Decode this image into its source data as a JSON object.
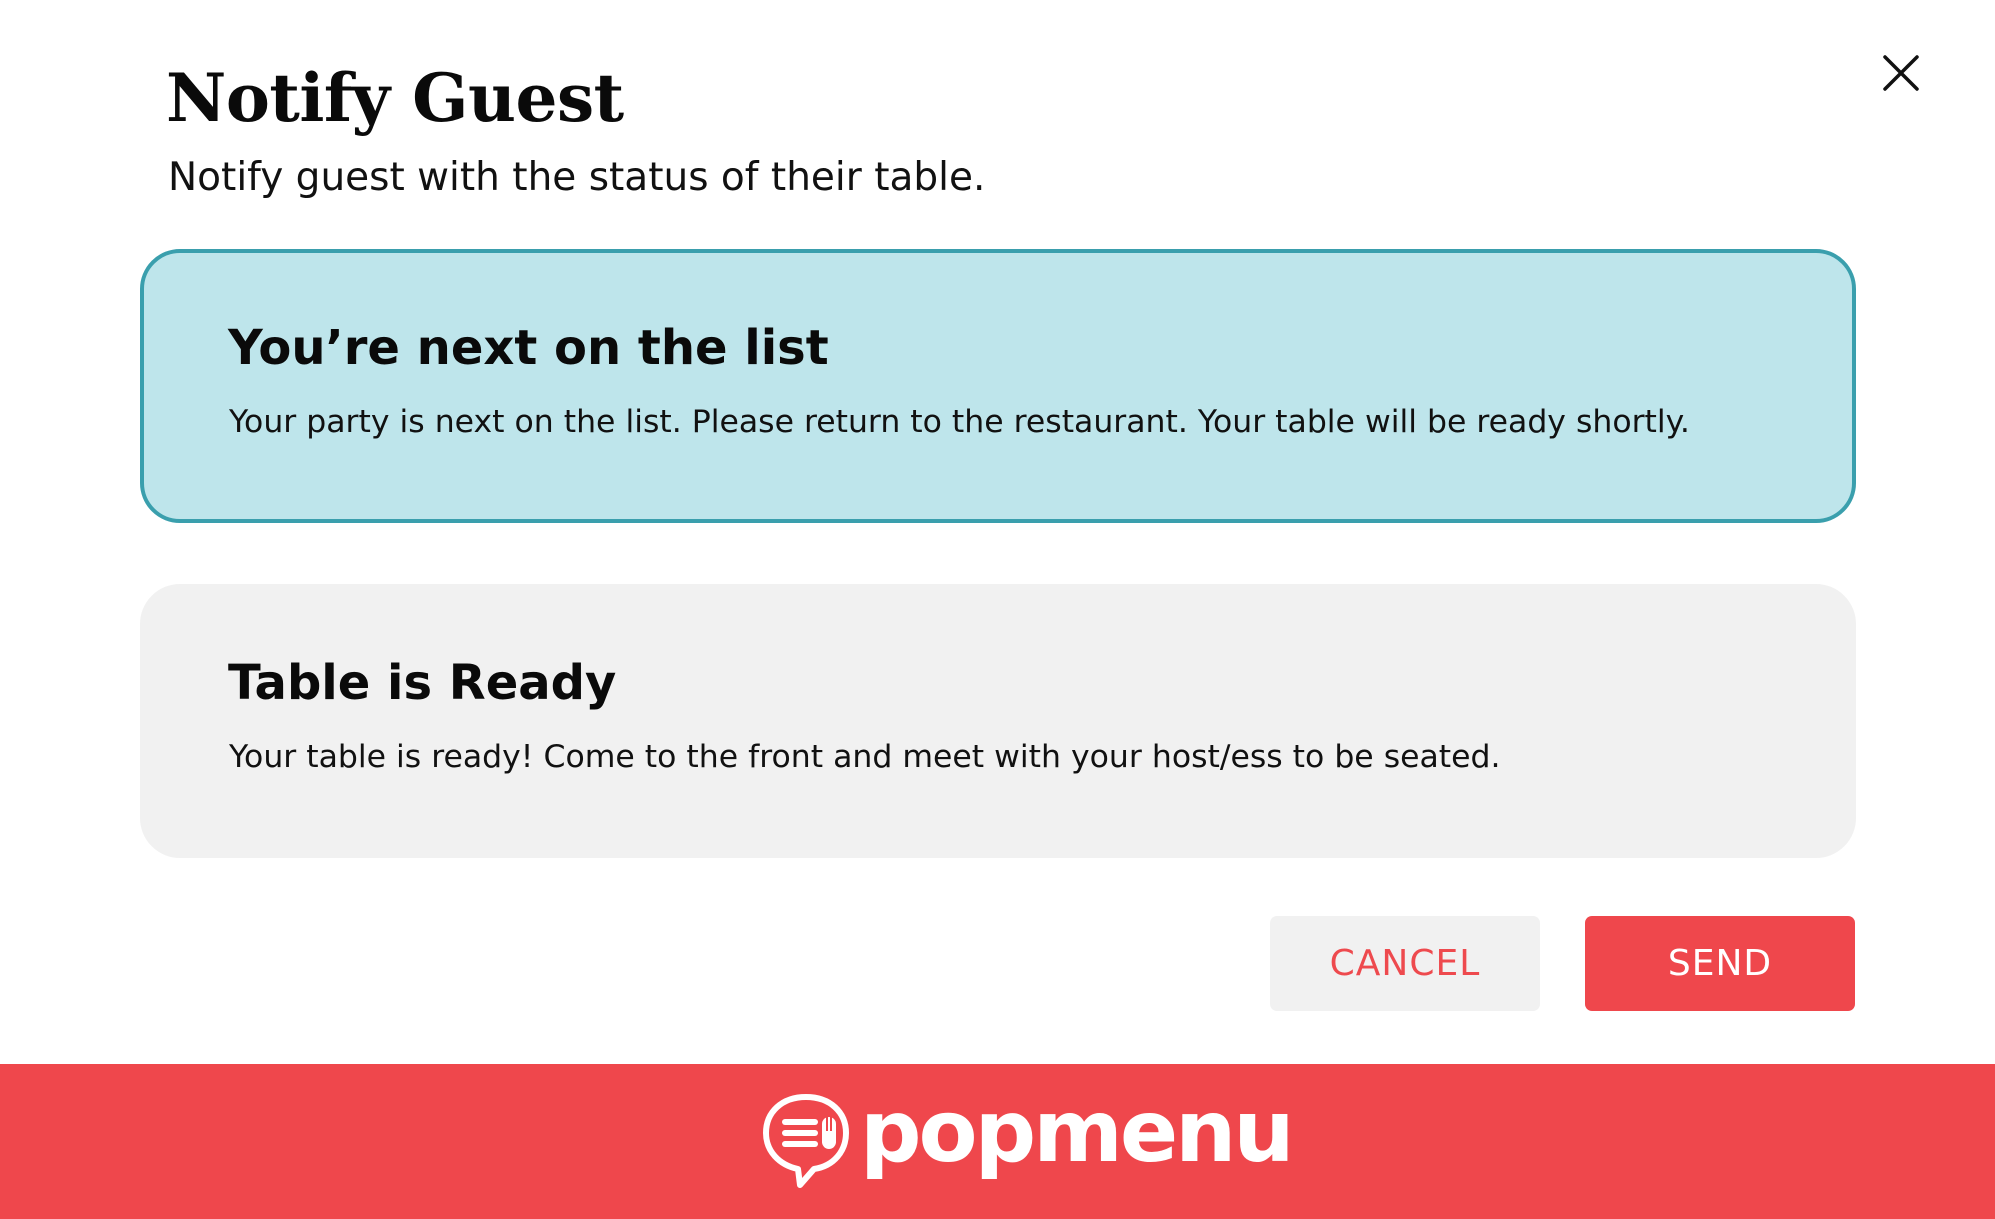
{
  "dialog": {
    "title": "Notify Guest",
    "subtitle": "Notify guest with the status of their table.",
    "close_icon": "close-icon"
  },
  "options": [
    {
      "title": "You’re next on the list",
      "description": "Your party is next on the list. Please return to the restaurant. Your table will be ready shortly.",
      "selected": true
    },
    {
      "title": "Table is Ready",
      "description": "Your table is ready! Come to the front and meet with your host/ess to be seated.",
      "selected": false
    }
  ],
  "actions": {
    "cancel_label": "CANCEL",
    "send_label": "SEND"
  },
  "footer": {
    "brand_name": "popmenu",
    "brand_icon": "chat-bubble-menu-icon"
  },
  "colors": {
    "brand_red": "#ef474c",
    "selected_bg": "#bee5eb",
    "selected_border": "#3a9fad",
    "card_bg": "#f1f1f1"
  }
}
